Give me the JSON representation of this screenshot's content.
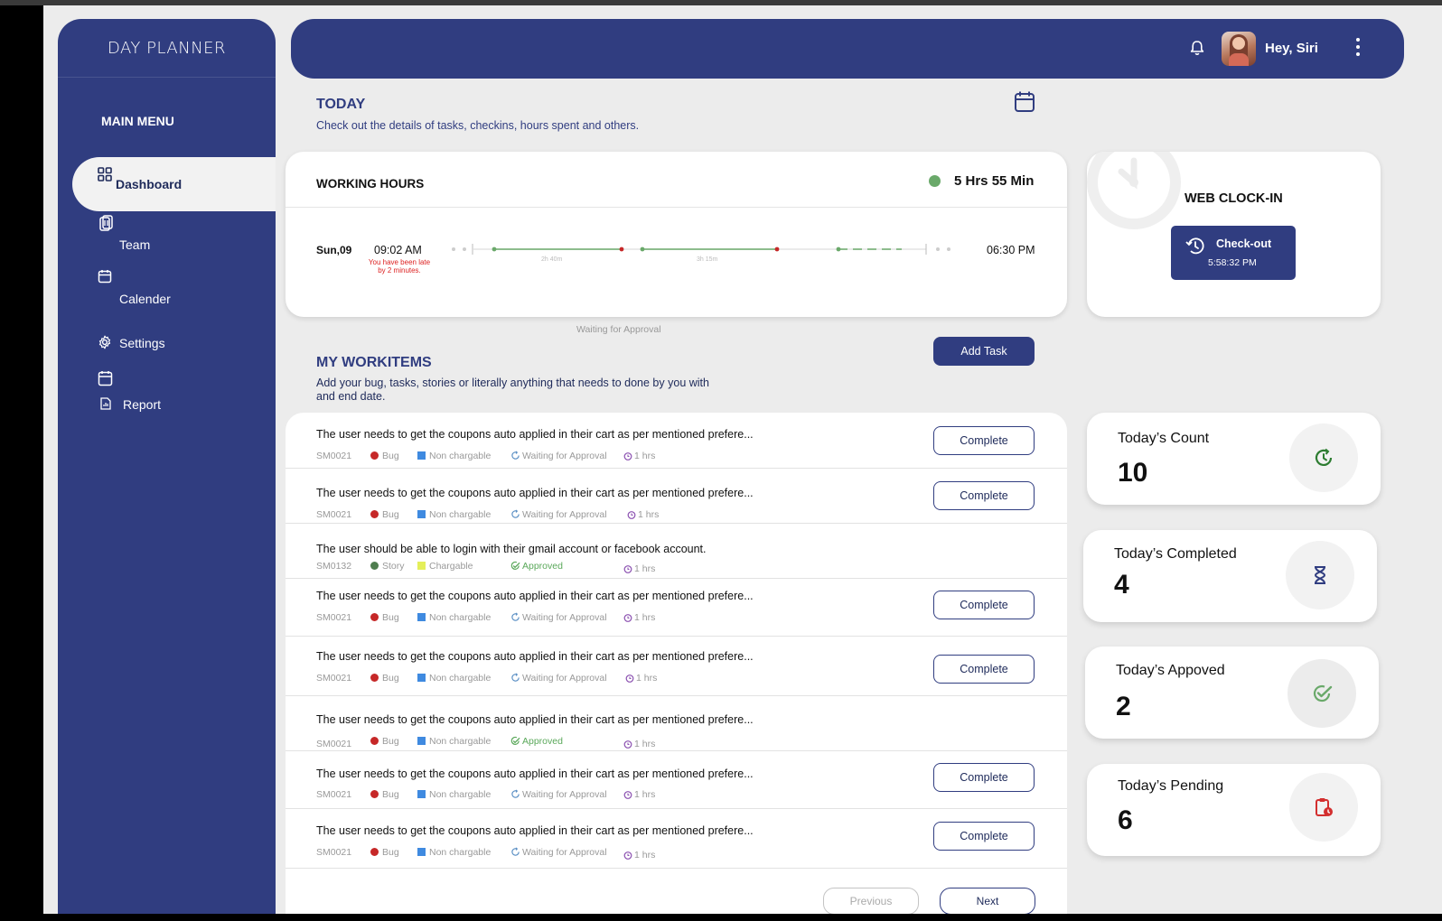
{
  "app": {
    "logo": "DAY PLANNER"
  },
  "sidebar": {
    "menu_title": "MAIN MENU",
    "items": [
      {
        "label": "Dashboard",
        "icon": "grid-icon",
        "active": true
      },
      {
        "label": "Team",
        "icon": "team-icon",
        "active": false
      },
      {
        "label": "Calender",
        "icon": "calendar-icon",
        "active": false
      },
      {
        "label": "Settings",
        "icon": "gear-icon",
        "active": false
      },
      {
        "label": "Report",
        "icon": "report-icon",
        "active": false
      }
    ]
  },
  "header": {
    "greeting": "Hey, Siri",
    "icons": [
      "bell-icon",
      "avatar",
      "kebab-menu-icon"
    ]
  },
  "today": {
    "title": "TODAY",
    "subtitle": "Check out the details of tasks, checkins, hours spent and others."
  },
  "working_hours": {
    "title": "WORKING HOURS",
    "total": "5 Hrs 55 Min",
    "status_color": "#6aa96a",
    "day": "Sun,09",
    "start_time": "09:02 AM",
    "late_note": "You have been late by 2 minutes.",
    "end_time": "06:30 PM",
    "segment_labels": [
      "2h 40m",
      "3h 15m"
    ],
    "caption": "Waiting for Approval"
  },
  "clock_in": {
    "title": "WEB CLOCK-IN",
    "button_label": "Check-out",
    "button_time": "5:58:32 PM"
  },
  "workitems": {
    "title": "MY WORKITEMS",
    "subtitle": "Add your bug, tasks, stories or literally anything that needs to done by you with and end date.",
    "add_button": "Add Task",
    "complete_label": "Complete",
    "previous_label": "Previous",
    "next_label": "Next",
    "items": [
      {
        "text": "The user needs to get the coupons auto applied in their cart as per mentioned prefere...",
        "id": "SM0021",
        "type": "Bug",
        "billing": "Non chargable",
        "status": "Waiting for Approval",
        "hours": "1 hrs",
        "has_complete": true
      },
      {
        "text": "The user needs to get the coupons auto applied in their cart as per mentioned prefere...",
        "id": "SM0021",
        "type": "Bug",
        "billing": "Non chargable",
        "status": "Waiting for Approval",
        "hours": "1 hrs",
        "has_complete": true
      },
      {
        "text": "The user should be able to login with their gmail account or facebook account.",
        "id": "SM0132",
        "type": "Story",
        "billing": "Chargable",
        "status": "Approved",
        "hours": "1 hrs",
        "has_complete": false
      },
      {
        "text": "The user needs to get the coupons auto applied in their cart as per mentioned prefere...",
        "id": "SM0021",
        "type": "Bug",
        "billing": "Non chargable",
        "status": "Waiting for Approval",
        "hours": "1 hrs",
        "has_complete": true
      },
      {
        "text": "The user needs to get the coupons auto applied in their cart as per mentioned prefere...",
        "id": "SM0021",
        "type": "Bug",
        "billing": "Non chargable",
        "status": "Waiting for Approval",
        "hours": "1 hrs",
        "has_complete": true
      },
      {
        "text": "The user needs to get the coupons auto applied in their cart as per mentioned prefere...",
        "id": "SM0021",
        "type": "Bug",
        "billing": "Non chargable",
        "status": "Approved",
        "hours": "1 hrs",
        "has_complete": false
      },
      {
        "text": "The user needs to get the coupons auto applied in their cart as per mentioned prefere...",
        "id": "SM0021",
        "type": "Bug",
        "billing": "Non chargable",
        "status": "Waiting for Approval",
        "hours": "1 hrs",
        "has_complete": true
      },
      {
        "text": "The user needs to get the coupons auto applied in their cart as per mentioned prefere...",
        "id": "SM0021",
        "type": "Bug",
        "billing": "Non chargable",
        "status": "Waiting for Approval",
        "hours": "1 hrs",
        "has_complete": true
      }
    ]
  },
  "stats": [
    {
      "label": "Today’s  Count",
      "value": "10",
      "icon": "clock-refresh-icon",
      "color": "#2e7d32"
    },
    {
      "label": "Today’s Completed",
      "value": "4",
      "icon": "hourglass-icon",
      "color": "#303d80"
    },
    {
      "label": "Today’s Appoved",
      "value": "2",
      "icon": "check-circle-icon",
      "color": "#6aa96a"
    },
    {
      "label": "Today’s Pending",
      "value": "6",
      "icon": "clipboard-clock-icon",
      "color": "#d32f2f"
    }
  ],
  "colors": {
    "primary": "#303d80",
    "bug": "#c62828",
    "story": "#4e7d4e",
    "non_chargable": "#3f8ae0",
    "chargable": "#e4ef5a",
    "approved": "#5aa85a",
    "waiting": "#5a8fc4",
    "hours": "#8a4fb0"
  }
}
